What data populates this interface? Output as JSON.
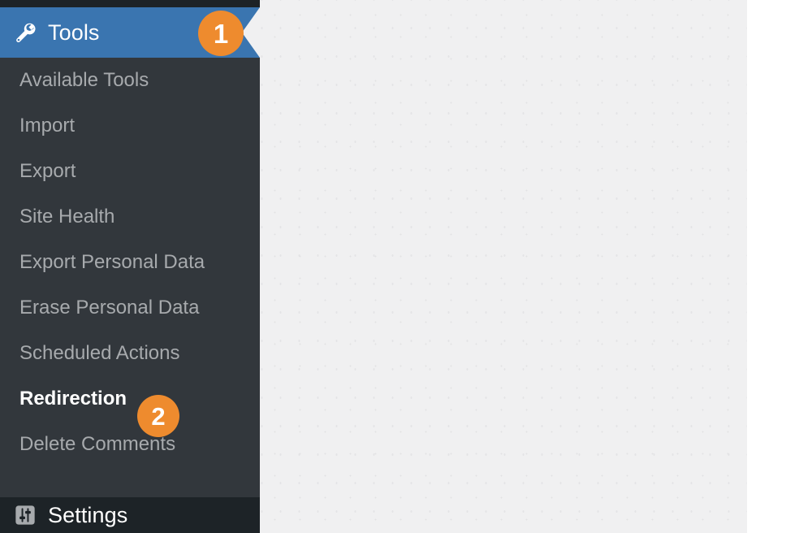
{
  "app": {
    "name": "WordPress Admin",
    "accent_blue": "#3a75b0",
    "sidebar_bg": "#32373c",
    "sidebar_dark_bg": "#1d2327",
    "content_bg": "#f0f0f1",
    "badge_color": "#ee8b2e",
    "submenu_text_color": "#a7aaad",
    "active_text_color": "#ffffff"
  },
  "sidebar": {
    "top_menu": {
      "label": "Tools",
      "icon": "wrench-icon",
      "state": "current-open"
    },
    "submenu_items": [
      {
        "label": "Available Tools",
        "current": false
      },
      {
        "label": "Import",
        "current": false
      },
      {
        "label": "Export",
        "current": false
      },
      {
        "label": "Site Health",
        "current": false
      },
      {
        "label": "Export Personal Data",
        "current": false
      },
      {
        "label": "Erase Personal Data",
        "current": false
      },
      {
        "label": "Scheduled Actions",
        "current": false
      },
      {
        "label": "Redirection",
        "current": true
      },
      {
        "label": "Delete Comments",
        "current": false
      }
    ],
    "bottom_menu": {
      "label": "Settings",
      "icon": "sliders-settings-icon"
    }
  },
  "annotations": {
    "badges": [
      {
        "number": "1",
        "target": "Tools"
      },
      {
        "number": "2",
        "target": "Redirection"
      }
    ]
  },
  "main": {
    "content": ""
  }
}
